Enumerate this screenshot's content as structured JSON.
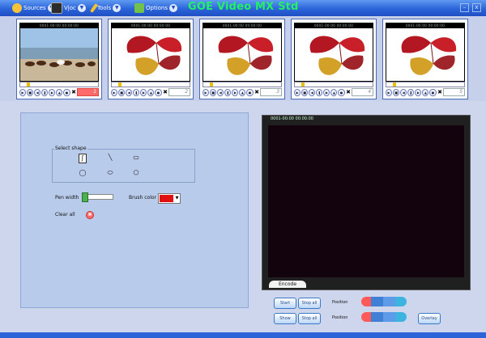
{
  "app": {
    "title": "GOE Video MX Std",
    "colors": {
      "titlebar": "#2b64d9",
      "title_text": "#23f065",
      "panel": "#b9cbea",
      "preview": "#12030c",
      "brush": "#e01010"
    }
  },
  "menu": [
    {
      "label": "Sources",
      "icon": "sources-icon"
    },
    {
      "label": "Vjoc",
      "icon": "vjoc-icon"
    },
    {
      "label": "Tools",
      "icon": "tools-icon"
    },
    {
      "label": "Options",
      "icon": "options-icon"
    }
  ],
  "window_buttons": [
    "–",
    "x"
  ],
  "cameras": [
    {
      "time": "0001-00:00 00:00:00",
      "label": "1",
      "active": true,
      "content": "horses-icon"
    },
    {
      "time": "0001-00:00 00:00:00",
      "label": "2",
      "active": false,
      "content": "leaf-icon"
    },
    {
      "time": "0001-00:00 00:00:00",
      "label": "3",
      "active": false,
      "content": "leaf-icon"
    },
    {
      "time": "0001-00:00 00:00:00",
      "label": "4",
      "active": false,
      "content": "leaf-icon"
    },
    {
      "time": "0001-00:00 00:00:00",
      "label": "5",
      "active": false,
      "content": "leaf-icon"
    }
  ],
  "draw_panel": {
    "select_shape_label": "Select shape",
    "shapes": [
      "freehand",
      "line",
      "rectangle",
      "circle",
      "ellipse",
      "polygon"
    ],
    "pen_label": "Pen width",
    "brush_label": "Brush color",
    "clear_label": "Clear all"
  },
  "preview": {
    "time": "0001-00:00 00:00:00",
    "tab": "Encode"
  },
  "controls": {
    "row1": {
      "btn1": "Start",
      "btn2": "Stop all",
      "pos": "Position"
    },
    "row2": {
      "btn1": "Show",
      "btn2": "Stop all",
      "pos": "Position",
      "extra": "Overlay"
    }
  }
}
